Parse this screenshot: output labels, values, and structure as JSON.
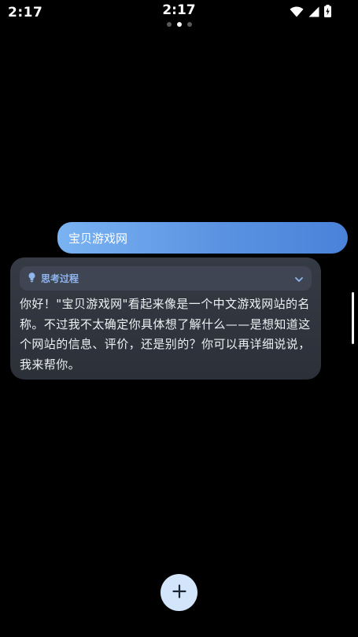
{
  "status_bar": {
    "time_left": "2:17",
    "time_center": "2:17",
    "icons": [
      "wifi-icon",
      "signal-icon",
      "battery-charging-icon"
    ]
  },
  "page_indicator": {
    "count": 3,
    "active_index": 1
  },
  "conversation": {
    "user_message": "宝贝游戏网",
    "assistant": {
      "thinking_label": "思考过程",
      "thinking_icon": "lightbulb-icon",
      "expand_icon": "chevron-down-icon",
      "response_text": "你好！\"宝贝游戏网\"看起来像是一个中文游戏网站的名称。不过我不太确定你具体想了解什么——是想知道这个网站的信息、评价，还是别的？你可以再详细说说，我来帮你。"
    }
  },
  "fab": {
    "icon": "plus-icon"
  },
  "colors": {
    "background": "#000000",
    "user_bubble_start": "#7ab3f2",
    "user_bubble_end": "#4a82d9",
    "card_background": "#2f333c",
    "thinking_header_background": "#3f4552",
    "accent": "#8fb6f0",
    "fab_background": "#d3e5fb"
  }
}
